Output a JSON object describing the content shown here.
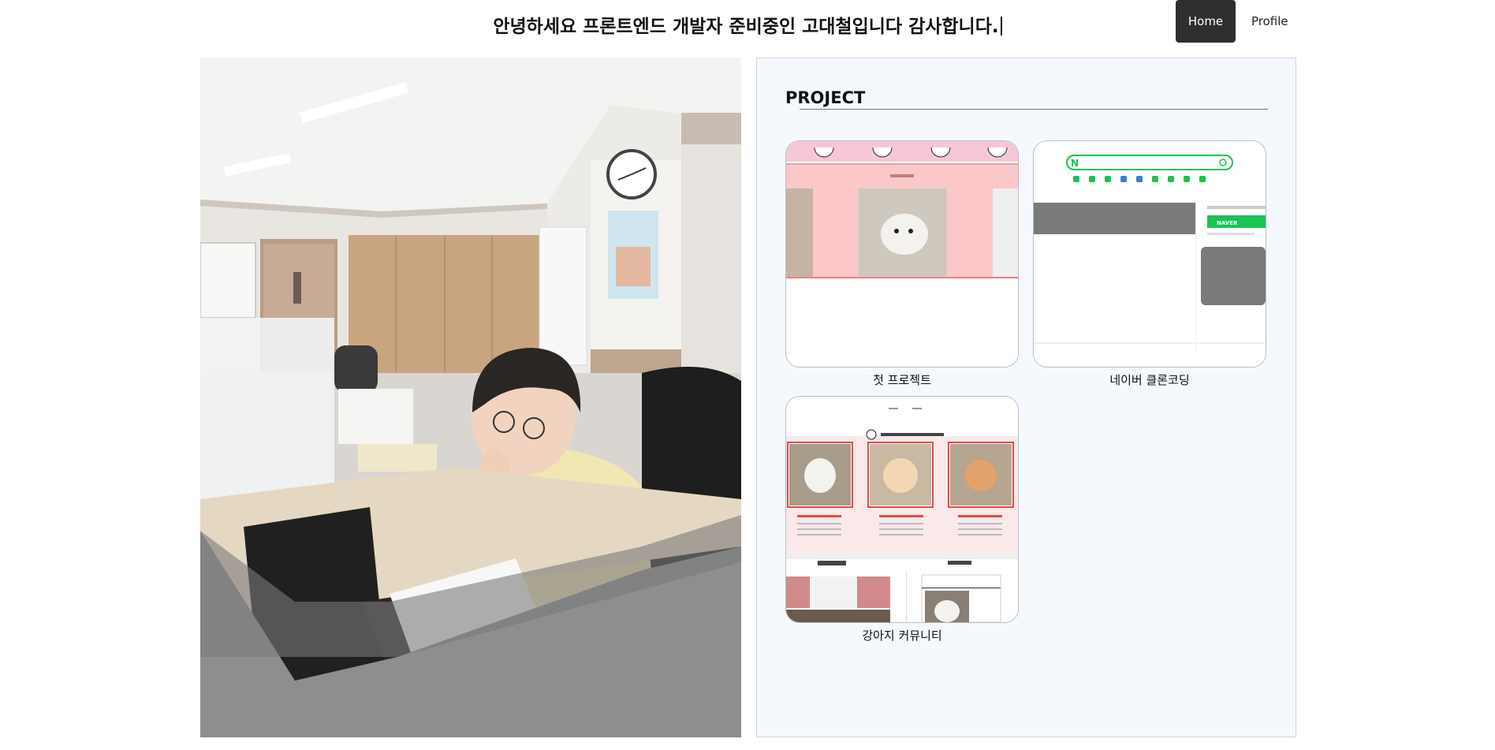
{
  "header": {
    "headline": "안녕하세요 프론트엔드 개발자 준비중인 고대철입니다 감사합니다.",
    "nav": [
      {
        "label": "Home",
        "active": true
      },
      {
        "label": "Profile",
        "active": false
      }
    ]
  },
  "project_section": {
    "title": "PROJECT",
    "projects": [
      {
        "name": "첫 프로젝트",
        "thumbnail": "pink-dog-gallery-site"
      },
      {
        "name": "네이버 클론코딩",
        "thumbnail": "naver-clone-site"
      },
      {
        "name": "강아지 커뮤니티",
        "thumbnail": "dog-community-site"
      }
    ]
  },
  "colors": {
    "accent_dark": "#2f2f2f",
    "panel_bg": "#f5f9fd",
    "naver_green": "#19c455",
    "pink": "#f7c9cd"
  }
}
